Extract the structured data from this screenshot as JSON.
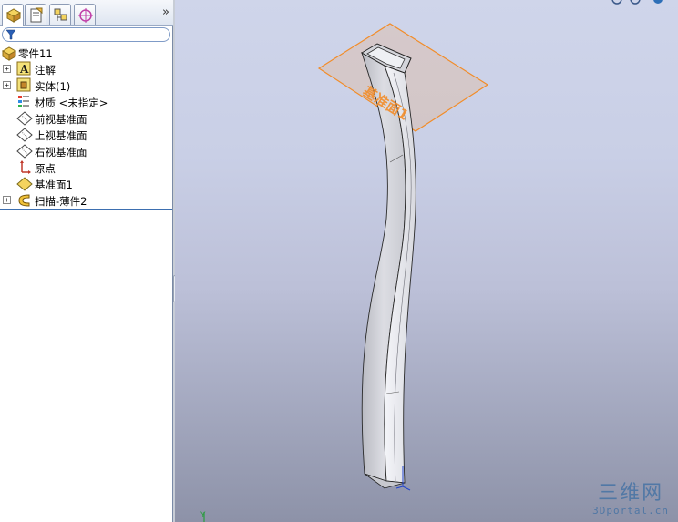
{
  "feature_tree": {
    "root_label": "零件11",
    "items": [
      {
        "label": "注解",
        "icon": "annotations-icon",
        "expandable": true
      },
      {
        "label": "实体(1)",
        "icon": "solid-bodies-icon",
        "expandable": true
      },
      {
        "label": "材质 <未指定>",
        "icon": "material-icon",
        "expandable": false
      },
      {
        "label": "前视基准面",
        "icon": "plane-icon",
        "expandable": false
      },
      {
        "label": "上视基准面",
        "icon": "plane-icon",
        "expandable": false
      },
      {
        "label": "右视基准面",
        "icon": "plane-icon",
        "expandable": false
      },
      {
        "label": "原点",
        "icon": "origin-icon",
        "expandable": false
      },
      {
        "label": "基准面1",
        "icon": "plane-icon",
        "expandable": false
      },
      {
        "label": "扫描-薄件2",
        "icon": "sweep-thin-feature-icon",
        "expandable": true
      }
    ]
  },
  "panel_tabs": [
    {
      "name": "featuremanager-tab",
      "icon": "featuremanager-icon",
      "active": true
    },
    {
      "name": "propertymanager-tab",
      "icon": "propertymanager-icon",
      "active": false
    },
    {
      "name": "configurationmanager-tab",
      "icon": "configurationmanager-icon",
      "active": false
    },
    {
      "name": "dimxpert-tab",
      "icon": "dimxpert-icon",
      "active": false
    }
  ],
  "more_tabs_glyph": "»",
  "viewport": {
    "plane_label": "基准面1",
    "plane_color": "#f28c28",
    "triad_label": "Y"
  },
  "watermark": {
    "title": "三维网",
    "url": "3Dportal.cn"
  },
  "colors": {
    "selection_line": "#3d6fb0",
    "plane": "#f28c28"
  }
}
